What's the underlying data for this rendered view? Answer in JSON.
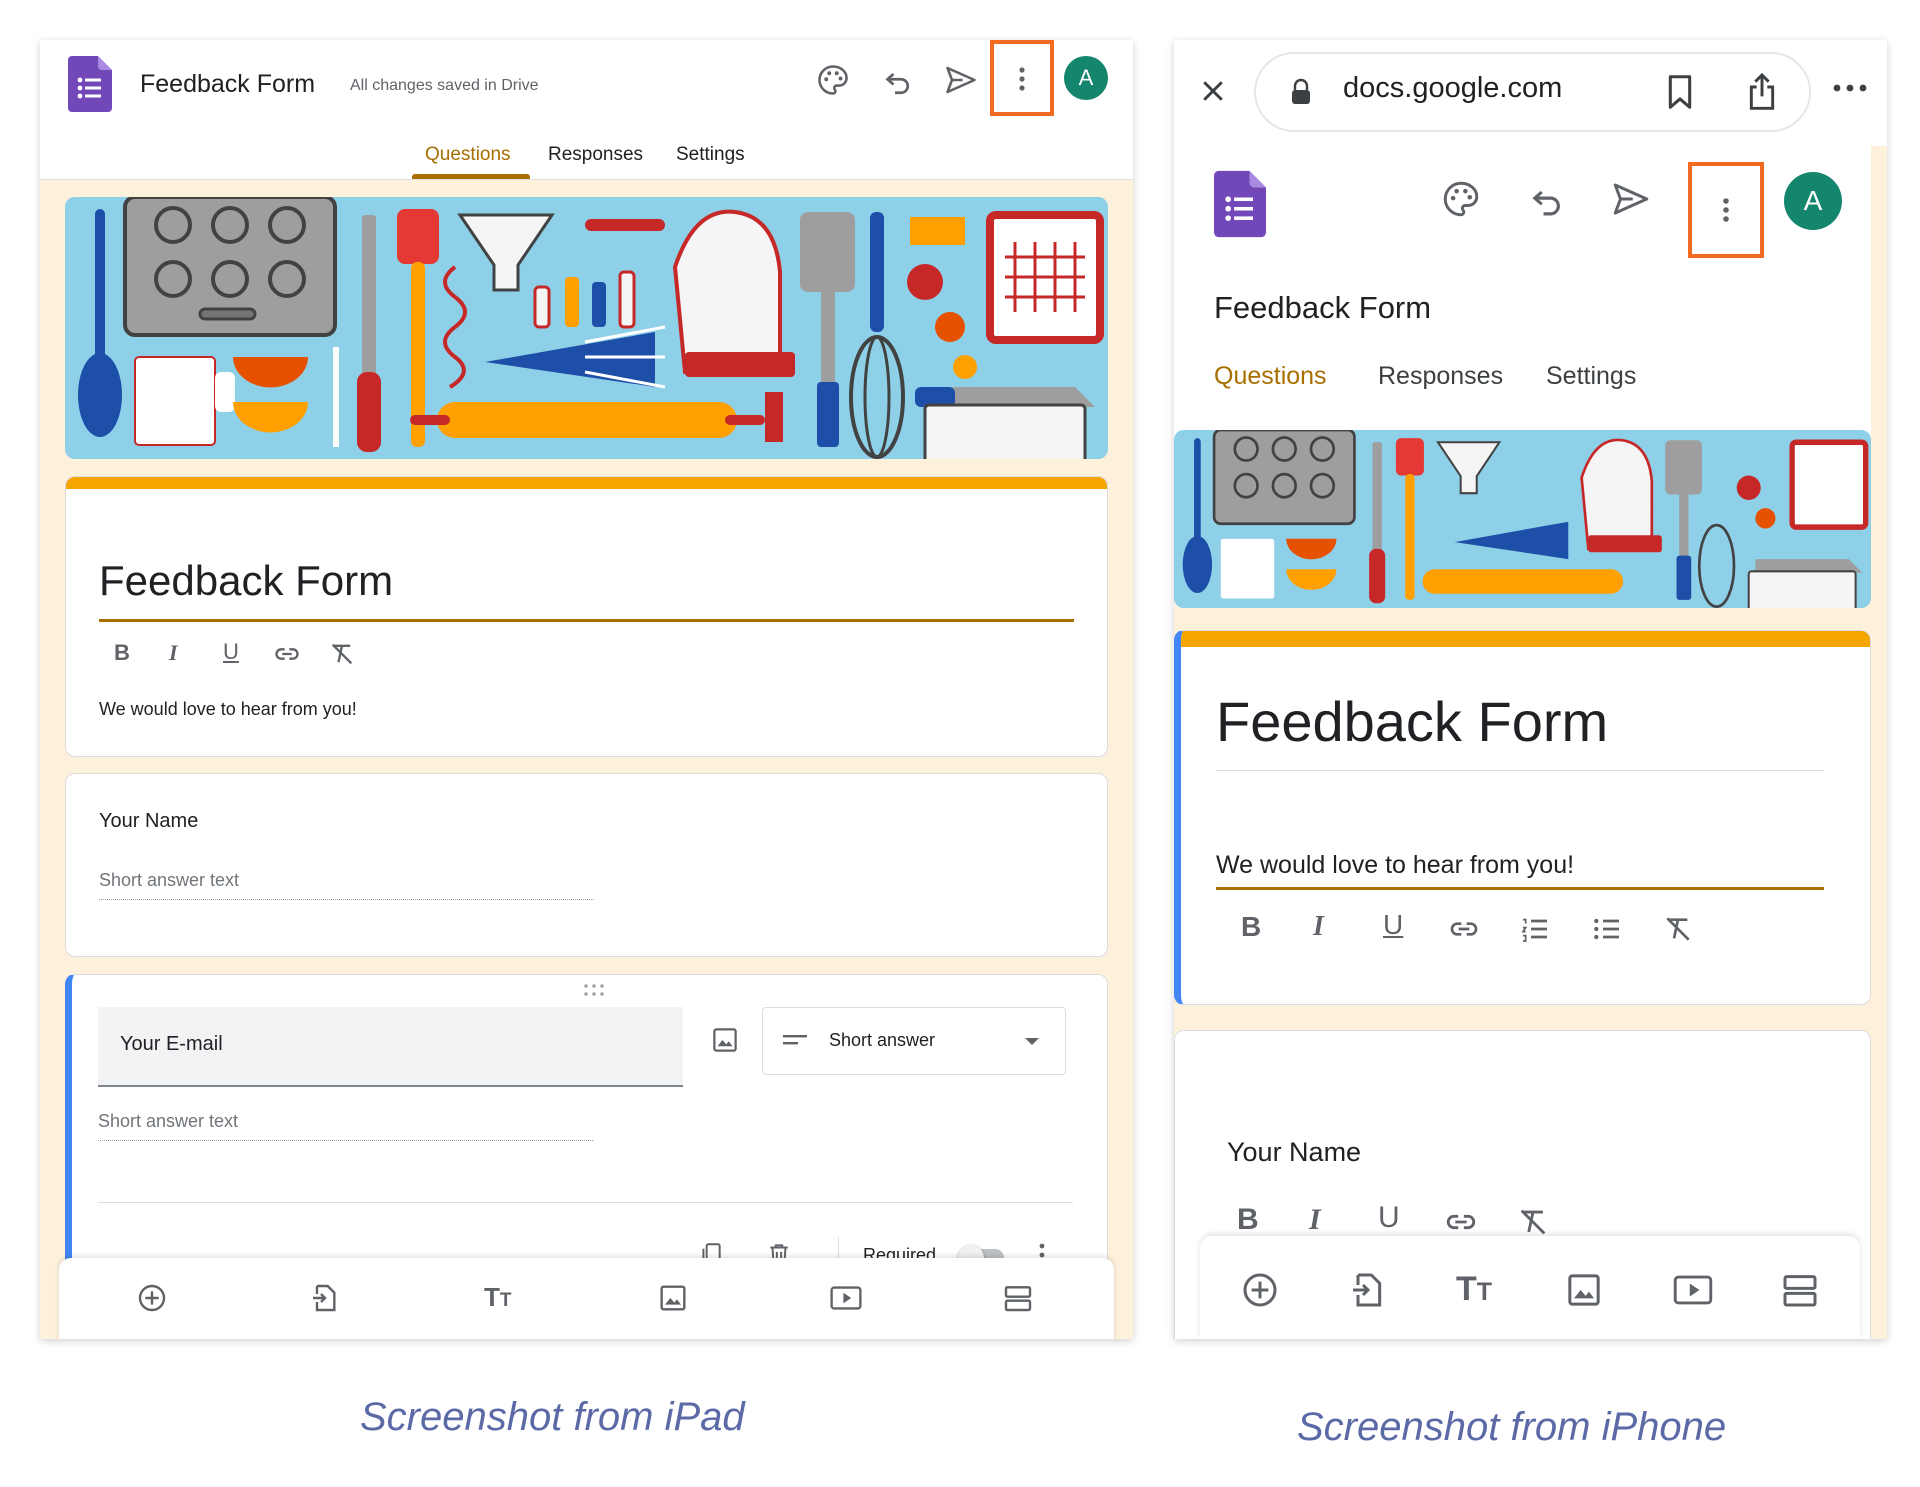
{
  "ipad": {
    "app_title": "Feedback Form",
    "save_status": "All changes saved in Drive",
    "avatar_letter": "A",
    "tabs": [
      "Questions",
      "Responses",
      "Settings"
    ],
    "form_title": "Feedback Form",
    "form_description": "We would love to hear from you!",
    "questions": [
      {
        "title": "Your Name",
        "placeholder": "Short answer text"
      },
      {
        "title": "Your E-mail",
        "placeholder": "Short answer text",
        "type": "Short answer",
        "required_label": "Required"
      }
    ]
  },
  "iphone": {
    "url": "docs.google.com",
    "avatar_letter": "A",
    "app_title": "Feedback Form",
    "tabs": [
      "Questions",
      "Responses",
      "Settings"
    ],
    "form_title": "Feedback Form",
    "form_description": "We would love to hear from you!",
    "question_title": "Your Name"
  },
  "captions": {
    "ipad": "Screenshot from iPad",
    "iphone": "Screenshot from iPhone"
  },
  "colors": {
    "accent": "#a86e00",
    "highlight_box": "#f26b21",
    "form_top_bar": "#f5a500",
    "avatar": "#14866d",
    "forms_icon": "#7248b9",
    "active_question_bar": "#4285f4"
  }
}
